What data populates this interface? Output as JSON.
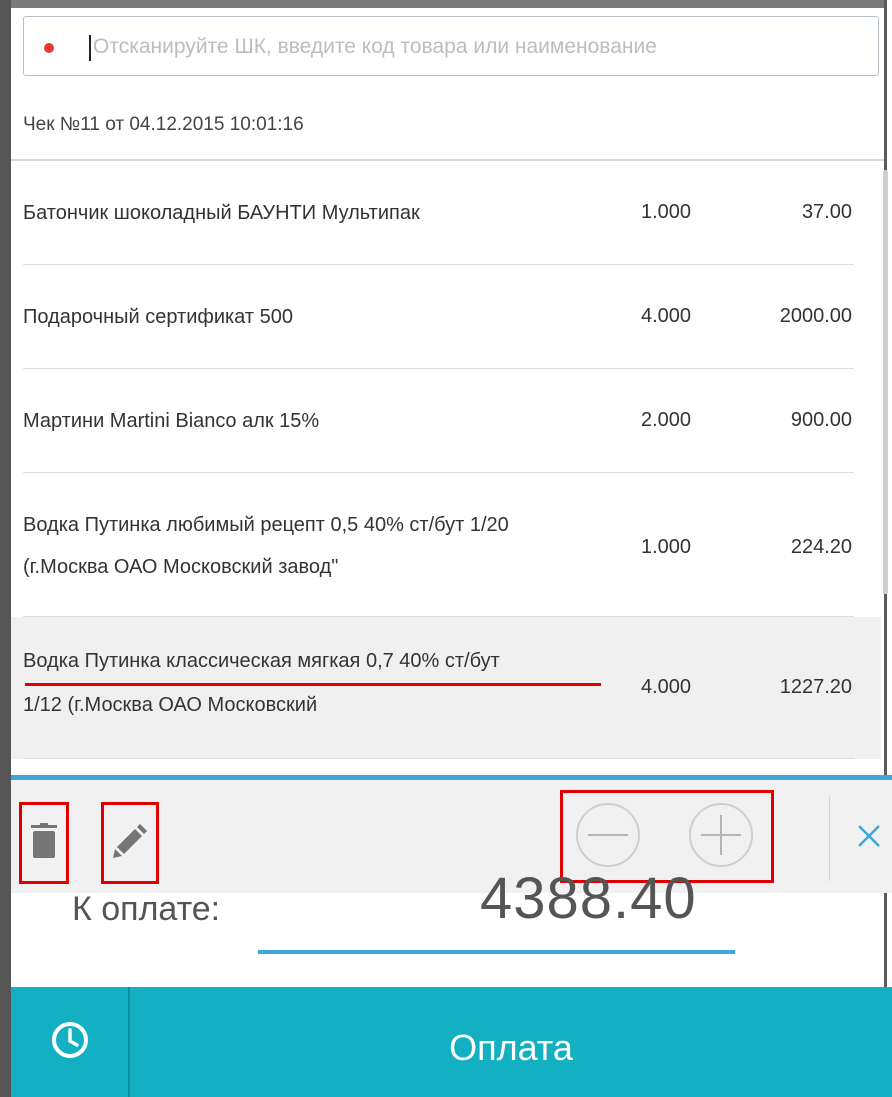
{
  "search": {
    "placeholder": "Отсканируйте ШК, введите код товара или наименование",
    "value": ""
  },
  "receipt": {
    "title": "Чек №11 от 04.12.2015 10:01:16"
  },
  "items": [
    {
      "name": "Батончик шоколадный БАУНТИ Мультипак",
      "qty": "1.000",
      "sum": "37.00"
    },
    {
      "name": "Подарочный сертификат 500",
      "qty": "4.000",
      "sum": "2000.00"
    },
    {
      "name": "Мартини Martini Bianco алк 15%",
      "qty": "2.000",
      "sum": "900.00"
    },
    {
      "name_line1": "Водка Путинка любимый рецепт 0,5 40% ст/бут 1/20",
      "name_line2": "(г.Москва ОАО Московский завод\"",
      "qty": "1.000",
      "sum": "224.20"
    },
    {
      "name_line1": "Водка Путинка классическая мягкая 0,7 40% ст/бут",
      "name_line2": "1/12 (г.Москва ОАО Московский",
      "qty": "4.000",
      "sum": "1227.20"
    }
  ],
  "toolbar": {
    "icons": [
      "trash-icon",
      "pencil-icon",
      "minus-icon",
      "plus-icon",
      "close-icon"
    ]
  },
  "total": {
    "label": "К оплате:",
    "value": "4388.40"
  },
  "footer": {
    "pay_label": "Оплата",
    "history_icon": "clock-icon"
  },
  "colors": {
    "accent": "#3aa8d8",
    "footer": "#13afc2",
    "highlight": "#e00000",
    "status_dot": "#e53935"
  }
}
